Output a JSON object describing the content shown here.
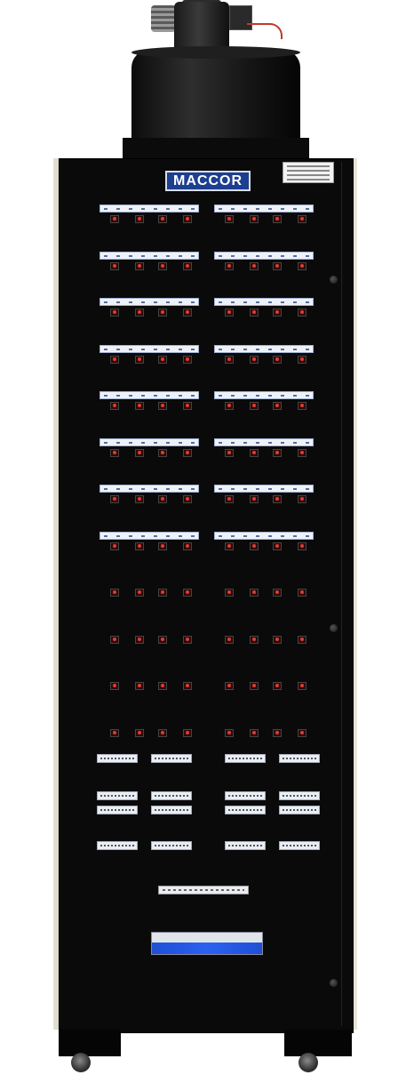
{
  "brand": {
    "logo_text": "MACCOR",
    "logo_color": "#1d3f8f"
  },
  "colors": {
    "cabinet": "#0a0a0a",
    "indicator": "#e23b2e",
    "panel_accent": "#2a62f0"
  },
  "equipment": {
    "channel_rows_with_labels": 8,
    "channel_rows_indicator_only": 4,
    "channels_per_group": 4,
    "groups_per_row": 2
  }
}
